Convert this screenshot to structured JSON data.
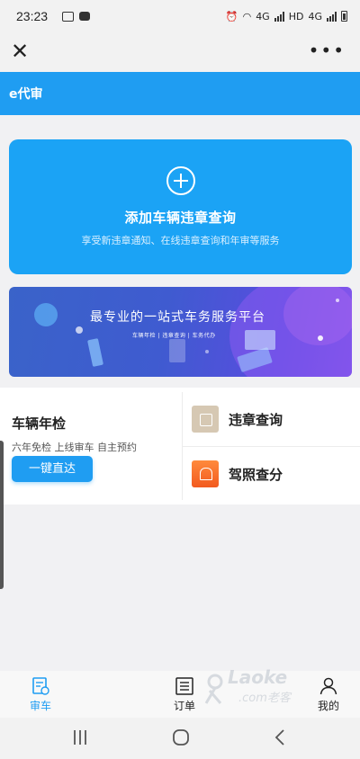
{
  "status_bar": {
    "time": "23:23",
    "network_labels": [
      "4G",
      "HD",
      "4G"
    ]
  },
  "nav": {
    "close_glyph": "✕",
    "more_glyph": "•••"
  },
  "header": {
    "title": "e代审"
  },
  "add_card": {
    "title": "添加车辆违章查询",
    "subtitle": "享受新违章通知、在线违章查询和年审等服务",
    "icon": "plus-circle-icon"
  },
  "banner": {
    "title": "最专业的一站式车务服务平台",
    "tags": "车辆年检 | 违章查询 | 车务代办"
  },
  "services": {
    "annual_inspection": {
      "title": "车辆年检",
      "subtitle": "六年免检 上线审车 自主预约",
      "button": "一键直达"
    },
    "items": [
      {
        "label": "违章查询",
        "icon": "violation-query-icon",
        "color": "#d6c8b3"
      },
      {
        "label": "驾照查分",
        "icon": "alarm-light-icon",
        "color": "#f25a1f"
      }
    ]
  },
  "tab_bar": {
    "tabs": [
      {
        "label": "审车",
        "icon": "car-check-icon",
        "active": true
      },
      {
        "label": "订单",
        "icon": "list-icon",
        "active": false
      },
      {
        "label": "我的",
        "icon": "user-icon",
        "active": false
      }
    ]
  },
  "watermark": {
    "text": "Laoke",
    "sub": ".com老客"
  },
  "colors": {
    "brand_blue": "#1f9df2",
    "card_blue": "#1ba3f5",
    "banner_purple": "#5a4ce0"
  }
}
